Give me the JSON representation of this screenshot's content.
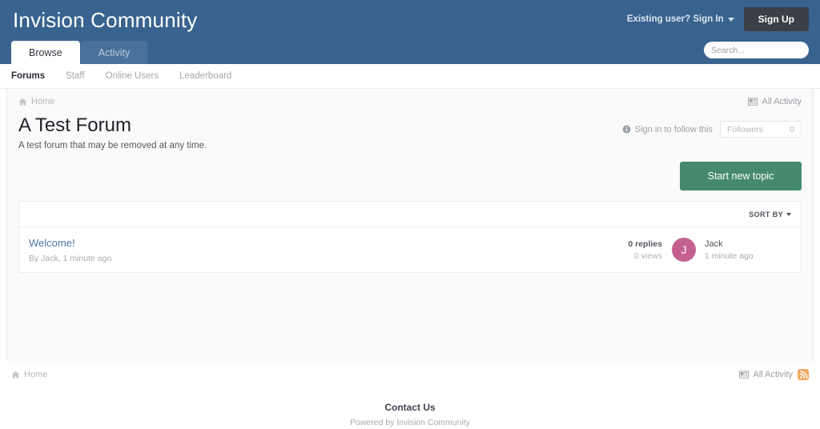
{
  "header": {
    "site_title": "Invision Community",
    "signin_label": "Existing user? Sign In",
    "signup_label": "Sign Up",
    "brand_color": "#39638f",
    "signup_color": "#3b3f46",
    "search": {
      "placeholder": "Search...",
      "value": ""
    },
    "tabs": [
      {
        "label": "Browse",
        "active": true
      },
      {
        "label": "Activity",
        "active": false
      }
    ]
  },
  "subnav": {
    "items": [
      {
        "label": "Forums",
        "active": true
      },
      {
        "label": "Staff",
        "active": false
      },
      {
        "label": "Online Users",
        "active": false
      },
      {
        "label": "Leaderboard",
        "active": false
      }
    ]
  },
  "breadcrumb": {
    "home_label": "Home",
    "all_activity_label": "All Activity"
  },
  "forum": {
    "title": "A Test Forum",
    "description": "A test forum that may be removed at any time.",
    "follow_label": "Sign in to follow this",
    "followers_label": "Followers",
    "followers_count": "0",
    "start_topic_label": "Start new topic",
    "start_topic_color": "#458a6f"
  },
  "topic_list": {
    "sort_label": "SORT BY",
    "topics": [
      {
        "title": "Welcome!",
        "meta": "By Jack, 1 minute ago",
        "replies": "0 replies",
        "views": "0 views",
        "avatar_initial": "J",
        "avatar_color": "#c4608f",
        "last_poster": "Jack",
        "last_time": "1 minute ago"
      }
    ]
  },
  "footer": {
    "home_label": "Home",
    "all_activity_label": "All Activity",
    "contact_label": "Contact Us",
    "powered_label": "Powered by Invision Community",
    "rss_color": "#f0a860"
  }
}
